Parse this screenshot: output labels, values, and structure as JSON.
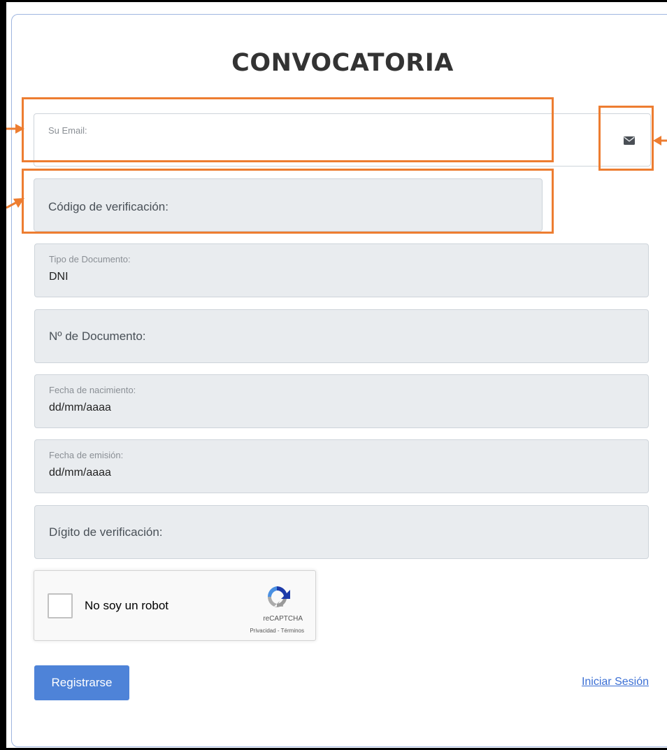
{
  "title": "CONVOCATORIA",
  "email": {
    "label": "Su Email:",
    "addon_icon": "envelope-icon"
  },
  "verification_code": {
    "placeholder": "Código de verificación:"
  },
  "document_type": {
    "label": "Tipo de Documento:",
    "value": "DNI"
  },
  "document_number": {
    "placeholder": "Nº de Documento:"
  },
  "birth_date": {
    "label": "Fecha de nacimiento:",
    "value": "dd/mm/aaaa"
  },
  "issue_date": {
    "label": "Fecha de emisión:",
    "value": "dd/mm/aaaa"
  },
  "check_digit": {
    "placeholder": "Dígito de verificación:"
  },
  "captcha": {
    "label": "No soy un robot",
    "brand": "reCAPTCHA",
    "links": "Privacidad - Términos"
  },
  "actions": {
    "register_label": "Registrarse",
    "login_link": "Iniciar Sesión"
  },
  "colors": {
    "annotation": "#ed7d31",
    "primary_button": "#4e83d8",
    "link": "#3b6fd4",
    "disabled_field": "#e9ecef"
  }
}
